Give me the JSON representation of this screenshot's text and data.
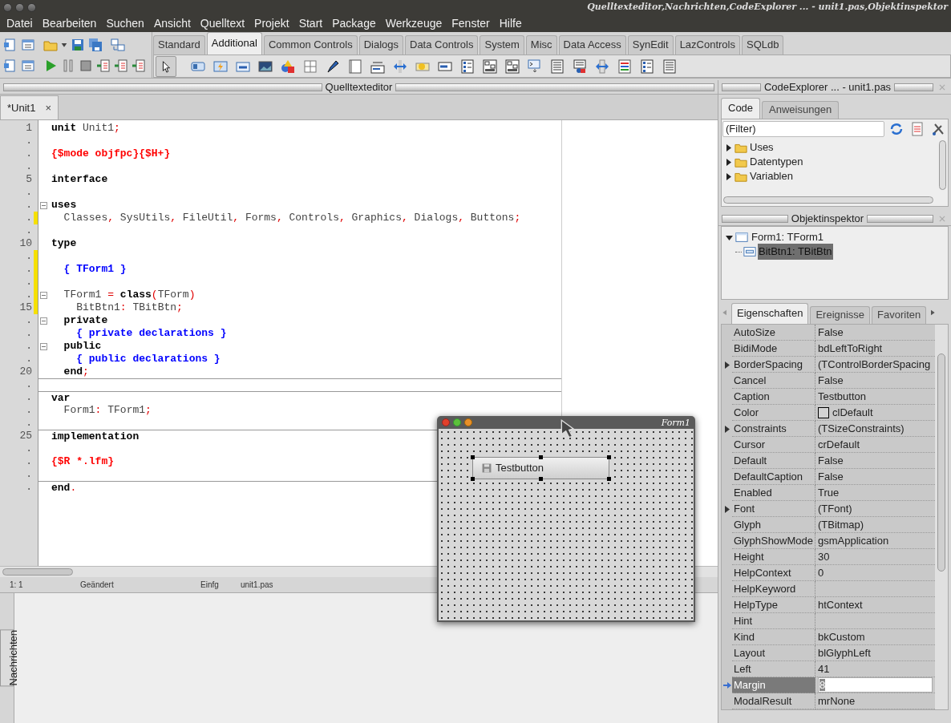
{
  "window": {
    "title": "Quelltexteditor,Nachrichten,CodeExplorer ... - unit1.pas,Objektinspektor"
  },
  "menu": [
    "Datei",
    "Bearbeiten",
    "Suchen",
    "Ansicht",
    "Quelltext",
    "Projekt",
    "Start",
    "Package",
    "Werkzeuge",
    "Fenster",
    "Hilfe"
  ],
  "palette_tabs": [
    {
      "label": "Standard",
      "selected": false
    },
    {
      "label": "Additional",
      "selected": true
    },
    {
      "label": "Common Controls",
      "selected": false
    },
    {
      "label": "Dialogs",
      "selected": false
    },
    {
      "label": "Data Controls",
      "selected": false
    },
    {
      "label": "System",
      "selected": false
    },
    {
      "label": "Misc",
      "selected": false
    },
    {
      "label": "Data Access",
      "selected": false
    },
    {
      "label": "SynEdit",
      "selected": false
    },
    {
      "label": "LazControls",
      "selected": false
    },
    {
      "label": "SQLdb",
      "selected": false
    }
  ],
  "editor": {
    "dock_title": "Quelltexteditor",
    "tabs": [
      {
        "label": "*Unit1",
        "close": "×",
        "selected": true
      }
    ],
    "lines": [
      {
        "gutter": "1",
        "modified": false,
        "fold": false,
        "rule": false,
        "tokens": [
          {
            "kind": "kw",
            "text": "unit"
          },
          {
            "kind": "id",
            "text": " Unit1"
          },
          {
            "kind": "sym",
            "text": ";"
          }
        ]
      },
      {
        "gutter": ".",
        "modified": false,
        "fold": false,
        "rule": false
      },
      {
        "gutter": ".",
        "modified": false,
        "fold": false,
        "rule": false,
        "tokens": [
          {
            "kind": "dir",
            "text": "{$mode objfpc}{$H+}"
          }
        ]
      },
      {
        "gutter": ".",
        "modified": false,
        "fold": false,
        "rule": false
      },
      {
        "gutter": "5",
        "modified": false,
        "fold": false,
        "rule": false,
        "tokens": [
          {
            "kind": "kw",
            "text": "interface"
          }
        ]
      },
      {
        "gutter": ".",
        "modified": false,
        "fold": false,
        "rule": false
      },
      {
        "gutter": ".",
        "modified": false,
        "fold": true,
        "rule": false,
        "tokens": [
          {
            "kind": "kw",
            "text": "uses"
          }
        ]
      },
      {
        "gutter": ".",
        "modified": true,
        "fold": false,
        "rule": false,
        "tokens": [
          {
            "kind": "id",
            "text": "  Classes"
          },
          {
            "kind": "sym",
            "text": ","
          },
          {
            "kind": "id",
            "text": " SysUtils"
          },
          {
            "kind": "sym",
            "text": ","
          },
          {
            "kind": "id",
            "text": " FileUtil"
          },
          {
            "kind": "sym",
            "text": ","
          },
          {
            "kind": "id",
            "text": " Forms"
          },
          {
            "kind": "sym",
            "text": ","
          },
          {
            "kind": "id",
            "text": " Controls"
          },
          {
            "kind": "sym",
            "text": ","
          },
          {
            "kind": "id",
            "text": " Graphics"
          },
          {
            "kind": "sym",
            "text": ","
          },
          {
            "kind": "id",
            "text": " Dialogs"
          },
          {
            "kind": "sym",
            "text": ","
          },
          {
            "kind": "id",
            "text": " Buttons"
          },
          {
            "kind": "sym",
            "text": ";"
          }
        ]
      },
      {
        "gutter": ".",
        "modified": false,
        "fold": false,
        "rule": false
      },
      {
        "gutter": "10",
        "modified": false,
        "fold": false,
        "rule": false,
        "tokens": [
          {
            "kind": "kw",
            "text": "type"
          }
        ]
      },
      {
        "gutter": ".",
        "modified": true,
        "fold": false,
        "rule": false
      },
      {
        "gutter": ".",
        "modified": true,
        "fold": false,
        "rule": false,
        "tokens": [
          {
            "kind": "cmt",
            "text": "  { TForm1 }"
          }
        ]
      },
      {
        "gutter": ".",
        "modified": true,
        "fold": false,
        "rule": false
      },
      {
        "gutter": ".",
        "modified": true,
        "fold": true,
        "rule": false,
        "tokens": [
          {
            "kind": "id",
            "text": "  TForm1 "
          },
          {
            "kind": "sym",
            "text": "="
          },
          {
            "kind": "kw",
            "text": " class"
          },
          {
            "kind": "sym",
            "text": "("
          },
          {
            "kind": "id",
            "text": "TForm"
          },
          {
            "kind": "sym",
            "text": ")"
          }
        ]
      },
      {
        "gutter": "15",
        "modified": true,
        "fold": false,
        "rule": false,
        "tokens": [
          {
            "kind": "id",
            "text": "    BitBtn1"
          },
          {
            "kind": "sym",
            "text": ":"
          },
          {
            "kind": "id",
            "text": " TBitBtn"
          },
          {
            "kind": "sym",
            "text": ";"
          }
        ]
      },
      {
        "gutter": ".",
        "modified": false,
        "fold": true,
        "rule": false,
        "tokens": [
          {
            "kind": "kw",
            "text": "  private"
          }
        ]
      },
      {
        "gutter": ".",
        "modified": false,
        "fold": false,
        "rule": false,
        "tokens": [
          {
            "kind": "cmt",
            "text": "    { private declarations }"
          }
        ]
      },
      {
        "gutter": ".",
        "modified": false,
        "fold": true,
        "rule": false,
        "tokens": [
          {
            "kind": "kw",
            "text": "  public"
          }
        ]
      },
      {
        "gutter": ".",
        "modified": false,
        "fold": false,
        "rule": false,
        "tokens": [
          {
            "kind": "cmt",
            "text": "    { public declarations }"
          }
        ]
      },
      {
        "gutter": "20",
        "modified": false,
        "fold": false,
        "rule": false,
        "tokens": [
          {
            "kind": "kw",
            "text": "  end"
          },
          {
            "kind": "sym",
            "text": ";"
          }
        ]
      },
      {
        "gutter": ".",
        "modified": false,
        "fold": false,
        "rule": true
      },
      {
        "gutter": ".",
        "modified": false,
        "fold": false,
        "rule": true,
        "tokens": [
          {
            "kind": "kw",
            "text": "var"
          }
        ]
      },
      {
        "gutter": ".",
        "modified": false,
        "fold": false,
        "rule": false,
        "tokens": [
          {
            "kind": "id",
            "text": "  Form1"
          },
          {
            "kind": "sym",
            "text": ":"
          },
          {
            "kind": "id",
            "text": " TForm1"
          },
          {
            "kind": "sym",
            "text": ";"
          }
        ]
      },
      {
        "gutter": ".",
        "modified": false,
        "fold": false,
        "rule": false
      },
      {
        "gutter": "25",
        "modified": false,
        "fold": false,
        "rule": true,
        "tokens": [
          {
            "kind": "kw",
            "text": "implementation"
          }
        ]
      },
      {
        "gutter": ".",
        "modified": false,
        "fold": false,
        "rule": false
      },
      {
        "gutter": ".",
        "modified": false,
        "fold": false,
        "rule": false,
        "tokens": [
          {
            "kind": "dir",
            "text": "{$R *.lfm}"
          }
        ]
      },
      {
        "gutter": ".",
        "modified": false,
        "fold": false,
        "rule": false
      },
      {
        "gutter": ".",
        "modified": false,
        "fold": false,
        "rule": true,
        "tokens": [
          {
            "kind": "kw",
            "text": "end"
          },
          {
            "kind": "sym",
            "text": "."
          }
        ]
      }
    ]
  },
  "status_bar": [
    "1: 1",
    "Geändert",
    "Einfg",
    "unit1.pas"
  ],
  "messages": {
    "tab": "Nachrichten"
  },
  "code_explorer": {
    "dock_title": "CodeExplorer ... - unit1.pas",
    "tabs": [
      {
        "label": "Code",
        "selected": true
      },
      {
        "label": "Anweisungen",
        "selected": false
      }
    ],
    "filter": {
      "value": "(Filter)"
    },
    "tree": [
      {
        "label": "Uses",
        "expanded": false
      },
      {
        "label": "Datentypen",
        "expanded": false
      },
      {
        "label": "Variablen",
        "expanded": false
      }
    ]
  },
  "object_inspector": {
    "dock_title": "Objektinspektor",
    "tree": [
      {
        "label": "Form1: TForm1",
        "expanded": true,
        "selected": false,
        "children": [
          {
            "label": "BitBtn1: TBitBtn",
            "selected": true
          }
        ]
      }
    ],
    "tabs": [
      {
        "label": "Eigenschaften",
        "selected": true
      },
      {
        "label": "Ereignisse",
        "selected": false
      },
      {
        "label": "Favoriten",
        "selected": false
      }
    ],
    "properties": [
      {
        "name": "AutoSize",
        "value": "False",
        "kind": "text",
        "expandable": false,
        "selected": false
      },
      {
        "name": "BidiMode",
        "value": "bdLeftToRight",
        "kind": "text",
        "expandable": false,
        "selected": false
      },
      {
        "name": "BorderSpacing",
        "value": "(TControlBorderSpacing",
        "kind": "text",
        "expandable": true,
        "selected": false
      },
      {
        "name": "Cancel",
        "value": "False",
        "kind": "text",
        "expandable": false,
        "selected": false
      },
      {
        "name": "Caption",
        "value": "Testbutton",
        "kind": "text",
        "expandable": false,
        "selected": false
      },
      {
        "name": "Color",
        "value": "clDefault",
        "kind": "color",
        "expandable": false,
        "selected": false
      },
      {
        "name": "Constraints",
        "value": "(TSizeConstraints)",
        "kind": "text",
        "expandable": true,
        "selected": false
      },
      {
        "name": "Cursor",
        "value": "crDefault",
        "kind": "text",
        "expandable": false,
        "selected": false
      },
      {
        "name": "Default",
        "value": "False",
        "kind": "text",
        "expandable": false,
        "selected": false
      },
      {
        "name": "DefaultCaption",
        "value": "False",
        "kind": "text",
        "expandable": false,
        "selected": false
      },
      {
        "name": "Enabled",
        "value": "True",
        "kind": "text",
        "expandable": false,
        "selected": false
      },
      {
        "name": "Font",
        "value": "(TFont)",
        "kind": "text",
        "expandable": true,
        "selected": false
      },
      {
        "name": "Glyph",
        "value": "(TBitmap)",
        "kind": "text",
        "expandable": false,
        "selected": false
      },
      {
        "name": "GlyphShowMode",
        "value": "gsmApplication",
        "kind": "text",
        "expandable": false,
        "selected": false
      },
      {
        "name": "Height",
        "value": "30",
        "kind": "text",
        "expandable": false,
        "selected": false
      },
      {
        "name": "HelpContext",
        "value": "0",
        "kind": "text",
        "expandable": false,
        "selected": false
      },
      {
        "name": "HelpKeyword",
        "kind": "text",
        "expandable": false,
        "selected": false
      },
      {
        "name": "HelpType",
        "value": "htContext",
        "kind": "text",
        "expandable": false,
        "selected": false
      },
      {
        "name": "Hint",
        "kind": "text",
        "expandable": false,
        "selected": false
      },
      {
        "name": "Kind",
        "value": "bkCustom",
        "kind": "text",
        "expandable": false,
        "selected": false
      },
      {
        "name": "Layout",
        "value": "blGlyphLeft",
        "kind": "text",
        "expandable": false,
        "selected": false
      },
      {
        "name": "Left",
        "value": "41",
        "kind": "text",
        "expandable": false,
        "selected": false
      },
      {
        "name": "Margin",
        "value": "8",
        "kind": "text",
        "expandable": false,
        "selected": true
      },
      {
        "name": "ModalResult",
        "value": "mrNone",
        "kind": "text",
        "expandable": false,
        "selected": false
      }
    ]
  },
  "form": {
    "title": "Form1",
    "button": {
      "label": "Testbutton",
      "selected": true
    }
  }
}
